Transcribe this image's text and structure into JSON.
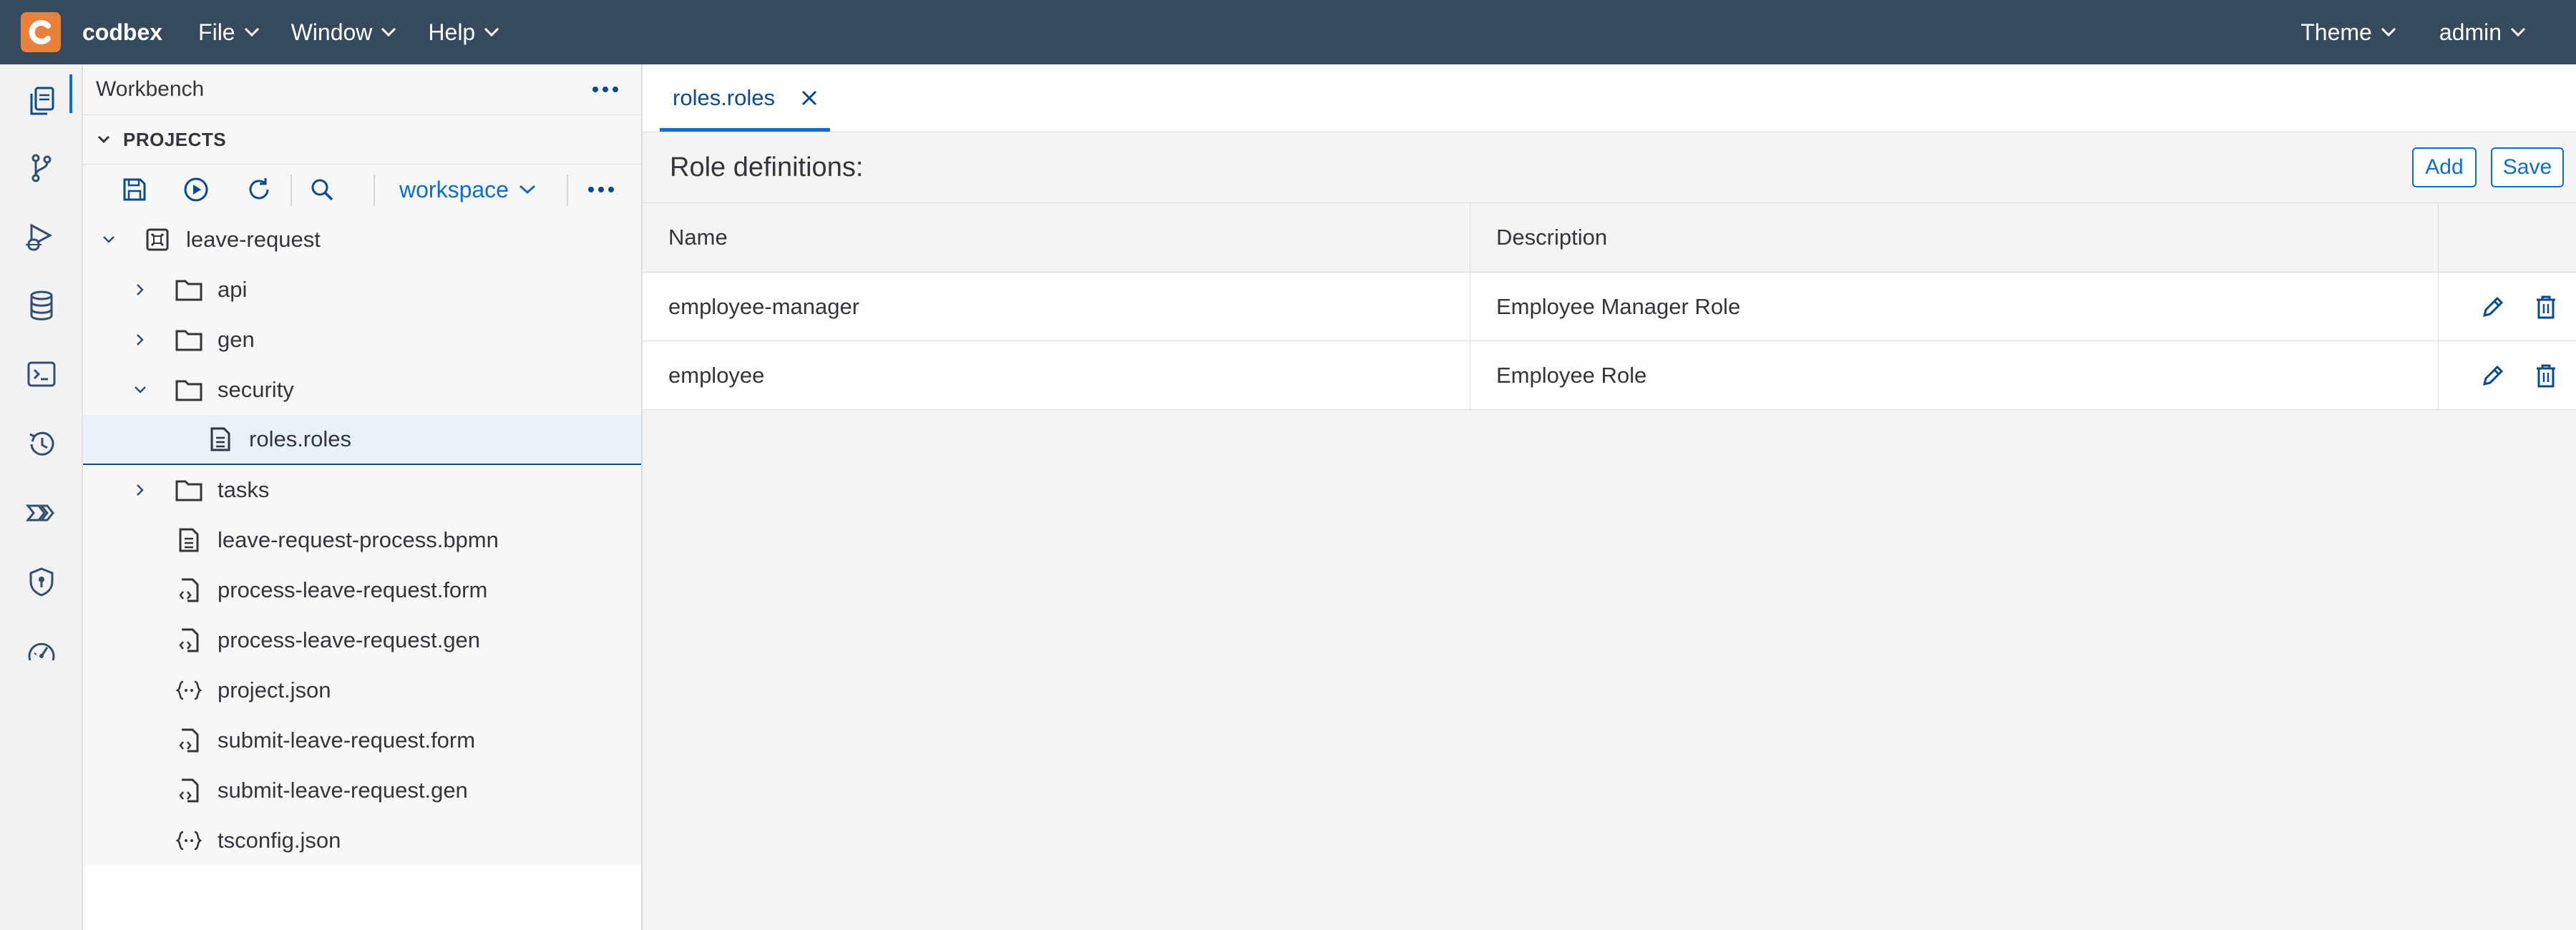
{
  "topbar": {
    "brand": "codbex",
    "menus": [
      "File",
      "Window",
      "Help"
    ],
    "right_menus": [
      "Theme",
      "admin"
    ]
  },
  "activity_bar": {
    "icons": [
      "projects-icon",
      "git-icon",
      "debug-icon",
      "database-icon",
      "terminal-icon",
      "history-icon",
      "pipeline-icon",
      "security-icon",
      "performance-icon"
    ]
  },
  "sidebar": {
    "title": "Workbench",
    "section": "PROJECTS",
    "workspace": "workspace",
    "tree": [
      {
        "label": "leave-request",
        "type": "project",
        "level": 0,
        "expanded": true
      },
      {
        "label": "api",
        "type": "folder",
        "level": 1,
        "expanded": false
      },
      {
        "label": "gen",
        "type": "folder",
        "level": 1,
        "expanded": false
      },
      {
        "label": "security",
        "type": "folder",
        "level": 1,
        "expanded": true
      },
      {
        "label": "roles.roles",
        "type": "file",
        "level": 2,
        "selected": true
      },
      {
        "label": "tasks",
        "type": "folder",
        "level": 1,
        "expanded": false
      },
      {
        "label": "leave-request-process.bpmn",
        "type": "file",
        "level": 1
      },
      {
        "label": "process-leave-request.form",
        "type": "code-file",
        "level": 1
      },
      {
        "label": "process-leave-request.gen",
        "type": "code-file",
        "level": 1
      },
      {
        "label": "project.json",
        "type": "json",
        "level": 1
      },
      {
        "label": "submit-leave-request.form",
        "type": "code-file",
        "level": 1
      },
      {
        "label": "submit-leave-request.gen",
        "type": "code-file",
        "level": 1
      },
      {
        "label": "tsconfig.json",
        "type": "json",
        "level": 1
      }
    ]
  },
  "editor": {
    "tab_label": "roles.roles",
    "title": "Role definitions:",
    "add_label": "Add",
    "save_label": "Save",
    "columns": [
      "Name",
      "Description"
    ],
    "rows": [
      {
        "name": "employee-manager",
        "description": "Employee Manager Role"
      },
      {
        "name": "employee",
        "description": "Employee Role"
      }
    ]
  },
  "colors": {
    "topbar": "#354a5f",
    "accent": "#0a6ed1",
    "logo": "#e9813d",
    "selected_row": "#e8f0f9"
  }
}
